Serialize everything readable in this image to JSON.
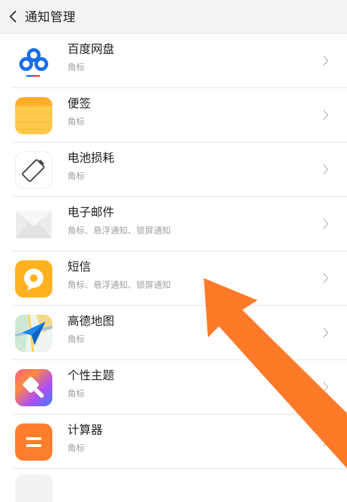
{
  "header": {
    "title": "通知管理"
  },
  "apps": [
    {
      "name": "百度网盘",
      "sub": "角标",
      "icon": "baidu-netdisk-icon"
    },
    {
      "name": "便签",
      "sub": "角标",
      "icon": "notes-icon"
    },
    {
      "name": "电池损耗",
      "sub": "角标",
      "icon": "battery-icon"
    },
    {
      "name": "电子邮件",
      "sub": "角标、悬浮通知、锁屏通知",
      "icon": "email-icon"
    },
    {
      "name": "短信",
      "sub": "角标、悬浮通知、锁屏通知",
      "icon": "sms-icon"
    },
    {
      "name": "高德地图",
      "sub": "角标",
      "icon": "amap-icon"
    },
    {
      "name": "个性主题",
      "sub": "角标",
      "icon": "theme-icon"
    },
    {
      "name": "计算器",
      "sub": "角标",
      "icon": "calculator-icon"
    }
  ],
  "colors": {
    "arrow": "#ff7a28",
    "sms": "#ffb21f",
    "notes": "#ffc94a",
    "calculator": "#ff7e2e"
  }
}
